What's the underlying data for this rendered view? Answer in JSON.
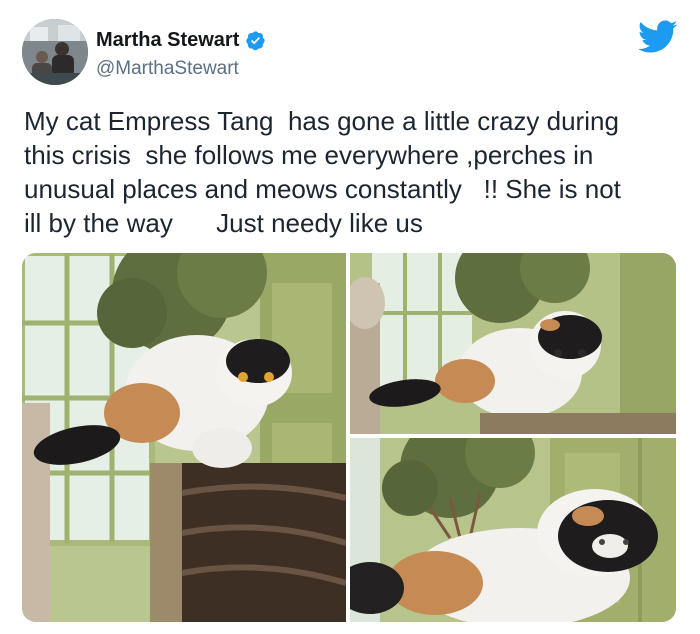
{
  "tweet": {
    "author": {
      "display_name": "Martha Stewart",
      "handle": "@MarthaStewart",
      "verified_icon": "verified-badge-icon",
      "avatar_icon": "avatar"
    },
    "text": "My cat Empress Tang  has gone a little crazy during\nthis crisis  she follows me everywhere ,perches in\nunusual places and meows constantly   !! She is not\nill by the way      Just needy like us",
    "platform_icon": "twitter-bird-icon",
    "media": {
      "photos": [
        {
          "description_icon": "photo-cat-on-post"
        },
        {
          "description_icon": "photo-cat-on-post-closeup"
        },
        {
          "description_icon": "photo-cat-near-plant"
        }
      ]
    }
  },
  "colors": {
    "brand": "#1d9bf0",
    "text": "#1c2530",
    "secondary_text": "#5b7083",
    "verified": "#1d9bf0"
  }
}
